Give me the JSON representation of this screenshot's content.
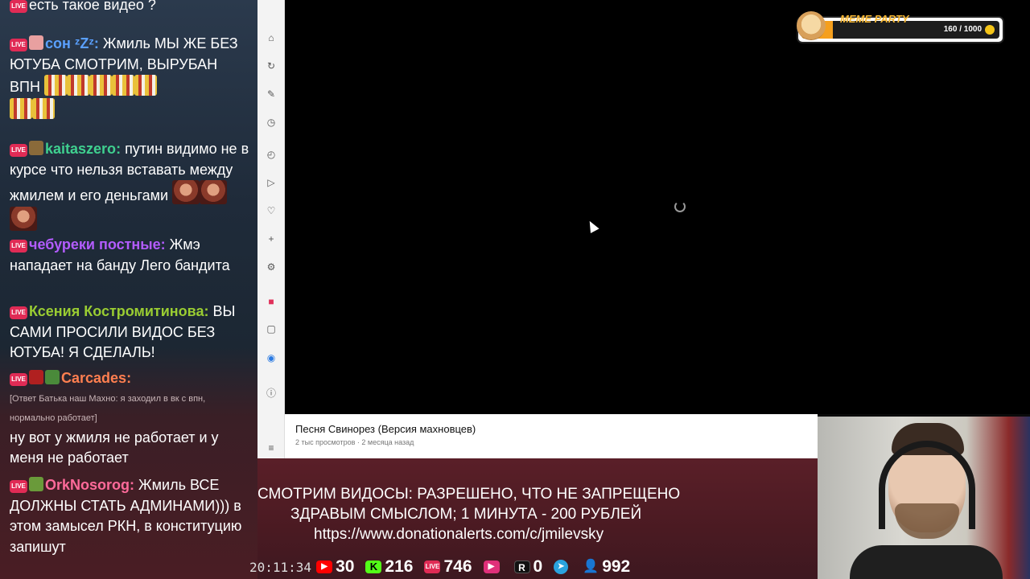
{
  "chat": {
    "badge_label": "LIVE",
    "messages": [
      {
        "user": "",
        "text": "есть такое видео ?",
        "user_color": "#ffffff"
      },
      {
        "user": "сон ᶻZᶻ",
        "text": "Жмиль МЫ ЖЕ БЕЗ ЮТУБА СМОТРИМ, ВЫРУБАН ВПН",
        "user_color": "#5aa0ff"
      },
      {
        "user": "kaitaszero",
        "text": "путин видимо не в курсе что нельзя вставать между жмилем и его деньгами",
        "user_color": "#3fd08f"
      },
      {
        "user": "чебуреки постные",
        "text": "Жмэ нападает на банду Лего бандита",
        "user_color": "#b35cff"
      },
      {
        "user": "Ксения Костромитинова",
        "text": "ВЫ САМИ ПРОСИЛИ ВИДОС БЕЗ ЮТУБА! Я СДЕЛАЛЬ!",
        "user_color": "#9acd32"
      },
      {
        "user": "Carcades",
        "reply": "[Ответ Батька наш Махно: я заходил в вк с впн, нормально работает]",
        "text": "ну вот у жмиля не работает и у меня не работает",
        "user_color": "#ff7f50"
      },
      {
        "user": "OrkNosorog",
        "text": "Жмиль ВСЕ ДОЛЖНЫ СТАТЬ АДМИНАМИ))) в этом замысел РКН, в конституцию запишут",
        "user_color": "#ff6a9a"
      }
    ]
  },
  "video": {
    "title": "Песня Свинорез (Версия махновцев)",
    "views": "2 тыс просмотров",
    "age": "2 месяца назад"
  },
  "meme_party": {
    "title": "MEME PARTY",
    "count": "160 / 1000",
    "progress": 0.16
  },
  "banner": {
    "line1": "СМОТРИМ ВИДОСЫ: РАЗРЕШЕНО, ЧТО НЕ ЗАПРЕЩЕНО",
    "line2": "ЗДРАВЫМ СМЫСЛОМ; 1 МИНУТА - 200 РУБЛЕЙ",
    "line3": "https://www.donationalerts.com/c/jmilevsky"
  },
  "stats": {
    "time": "20:11:34",
    "youtube": "30",
    "kick": "216",
    "vk_live": "746",
    "rutube_play": "",
    "r_label": "R",
    "r_value": "0",
    "telegram": "",
    "followers": "992"
  },
  "colors": {
    "youtube": "#ff0000",
    "kick": "#53fc18",
    "vk_live": "#e02b55",
    "telegram": "#2aa3df",
    "followers": "#4ea7ff",
    "meme_accent": "#f59f1d"
  }
}
